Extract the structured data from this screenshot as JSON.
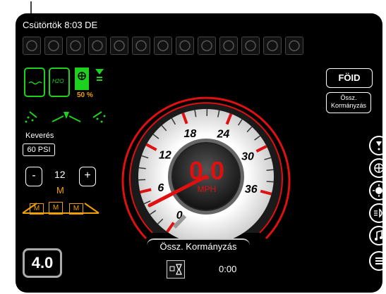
{
  "status": {
    "datetime": "Csütörtök 8:03 DE"
  },
  "top_icons": [
    "sensor-icon",
    "warning-icon",
    "stop-icon",
    "pump-icon",
    "water-level-icon",
    "valve-icon",
    "valve-flow-icon",
    "nozzle-icon",
    "fill-icon",
    "tank-icon",
    "agitator-icon",
    "hose-icon",
    "rinse-icon"
  ],
  "tanks": {
    "fan_percent": "50 %",
    "h2o_label": "H2O"
  },
  "agitation": {
    "label": "Keverés",
    "value": "60 PSI"
  },
  "boom": {
    "count": "12",
    "unit": "M",
    "minus": "-",
    "plus": "+",
    "sections": [
      "M",
      "M",
      "M"
    ]
  },
  "speed": {
    "value": "0.0",
    "unit": "MPH",
    "ticks": [
      "0",
      "6",
      "12",
      "18",
      "24",
      "30",
      "36"
    ],
    "mode_label": "Össz. Kormányzás",
    "value_num": 0,
    "max": 36
  },
  "right_buttons": {
    "foid": "FÖID",
    "steering": "Össz. Kormányzás"
  },
  "bottom": {
    "gear": "4.0",
    "timer": "0:00"
  },
  "colors": {
    "accent_red": "#e01010",
    "green": "#1ed11e",
    "orange": "#f0a000"
  }
}
